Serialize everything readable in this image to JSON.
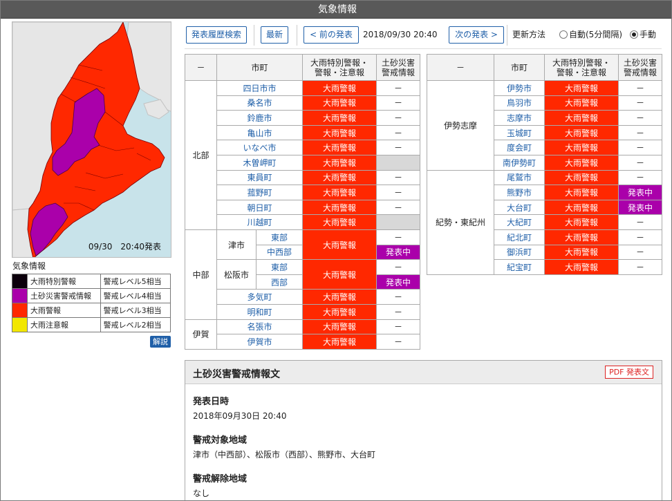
{
  "window": {
    "title": "気象情報"
  },
  "map": {
    "timestamp": "09/30　20:40発表"
  },
  "legend": {
    "title": "気象情報",
    "items": [
      {
        "name": "大雨特別警報",
        "level": "警戒レベル5相当",
        "color": "#0c000c"
      },
      {
        "name": "土砂災害警戒情報",
        "level": "警戒レベル4相当",
        "color": "#aa00aa"
      },
      {
        "name": "大雨警報",
        "level": "警戒レベル3相当",
        "color": "#ff2800"
      },
      {
        "name": "大雨注意報",
        "level": "警戒レベル2相当",
        "color": "#f2e700"
      }
    ],
    "help_label": "解説"
  },
  "toolbar": {
    "history_label": "発表履歴検索",
    "latest_label": "最新",
    "prev_label": "< 前の発表",
    "datetime": "2018/09/30 20:40",
    "next_label": "次の発表 >",
    "update_label": "更新方法",
    "auto_label": "自動(5分間隔)",
    "manual_label": "手動"
  },
  "tables": {
    "header": {
      "dash": "－",
      "city": "市町",
      "warn1": "大雨特別警報・",
      "warn2": "警報・注意報",
      "land1": "土砂災害",
      "land2": "警戒情報"
    },
    "left": {
      "north": {
        "region": "北部",
        "rows": [
          {
            "city": "四日市市",
            "warn": "大雨警報",
            "land": "－"
          },
          {
            "city": "桑名市",
            "warn": "大雨警報",
            "land": "－"
          },
          {
            "city": "鈴鹿市",
            "warn": "大雨警報",
            "land": "－"
          },
          {
            "city": "亀山市",
            "warn": "大雨警報",
            "land": "－"
          },
          {
            "city": "いなべ市",
            "warn": "大雨警報",
            "land": "－"
          },
          {
            "city": "木曽岬町",
            "warn": "大雨警報",
            "land": ""
          },
          {
            "city": "東員町",
            "warn": "大雨警報",
            "land": "－"
          },
          {
            "city": "菰野町",
            "warn": "大雨警報",
            "land": "－"
          },
          {
            "city": "朝日町",
            "warn": "大雨警報",
            "land": "－"
          },
          {
            "city": "川越町",
            "warn": "大雨警報",
            "land": ""
          }
        ]
      },
      "middle": {
        "region": "中部",
        "tsu": {
          "city": "津市",
          "warn": "大雨警報",
          "subs": [
            {
              "name": "東部",
              "land": "－"
            },
            {
              "name": "中西部",
              "land": "発表中"
            }
          ]
        },
        "matsusaka": {
          "city": "松阪市",
          "warn": "大雨警報",
          "subs": [
            {
              "name": "東部",
              "land": "－"
            },
            {
              "name": "西部",
              "land": "発表中"
            }
          ]
        },
        "rows": [
          {
            "city": "多気町",
            "warn": "大雨警報",
            "land": "－"
          },
          {
            "city": "明和町",
            "warn": "大雨警報",
            "land": "－"
          }
        ]
      },
      "iga": {
        "region": "伊賀",
        "rows": [
          {
            "city": "名張市",
            "warn": "大雨警報",
            "land": "－"
          },
          {
            "city": "伊賀市",
            "warn": "大雨警報",
            "land": "－"
          }
        ]
      }
    },
    "right": {
      "ise": {
        "region": "伊勢志摩",
        "rows": [
          {
            "city": "伊勢市",
            "warn": "大雨警報",
            "land": "－"
          },
          {
            "city": "鳥羽市",
            "warn": "大雨警報",
            "land": "－"
          },
          {
            "city": "志摩市",
            "warn": "大雨警報",
            "land": "－"
          },
          {
            "city": "玉城町",
            "warn": "大雨警報",
            "land": "－"
          },
          {
            "city": "度会町",
            "warn": "大雨警報",
            "land": "－"
          },
          {
            "city": "南伊勢町",
            "warn": "大雨警報",
            "land": "－"
          }
        ]
      },
      "kisei": {
        "region": "紀勢・東紀州",
        "rows": [
          {
            "city": "尾鷲市",
            "warn": "大雨警報",
            "land": "－"
          },
          {
            "city": "熊野市",
            "warn": "大雨警報",
            "land": "発表中"
          },
          {
            "city": "大台町",
            "warn": "大雨警報",
            "land": "発表中"
          },
          {
            "city": "大紀町",
            "warn": "大雨警報",
            "land": "－"
          },
          {
            "city": "紀北町",
            "warn": "大雨警報",
            "land": "－"
          },
          {
            "city": "御浜町",
            "warn": "大雨警報",
            "land": "－"
          },
          {
            "city": "紀宝町",
            "warn": "大雨警報",
            "land": "－"
          }
        ]
      }
    }
  },
  "panel": {
    "title": "土砂災害警戒情報文",
    "pdf_label": "PDF 発表文",
    "issued_heading": "発表日時",
    "issued_value": "2018年09月30日 20:40",
    "target_heading": "警戒対象地域",
    "target_value": "津市（中西部）、松阪市（西部）、熊野市、大台町",
    "lifted_heading": "警戒解除地域",
    "lifted_value": "なし"
  }
}
